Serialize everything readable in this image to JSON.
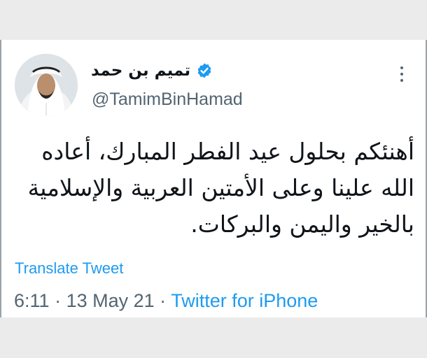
{
  "tweet": {
    "author": {
      "display_name": "تميم بن حمد",
      "handle": "@TamimBinHamad",
      "verified": true
    },
    "text_lines": [
      "أهنئكم بحلول عيد الفطر المبارك، أعاده",
      "الله علينا وعلى الأمتين العربية والإسلامية",
      "بالخير واليمن والبركات."
    ],
    "translate_label": "Translate Tweet",
    "time": "6:11",
    "separator": "·",
    "date": "13 May 21",
    "source": "Twitter for iPhone"
  },
  "icons": {
    "verified": "verified-badge-icon",
    "more": "more-options-icon"
  },
  "colors": {
    "accent": "#1d9bf0",
    "secondary_text": "#536471",
    "primary_text": "#0f1419",
    "page_background": "#ebebeb",
    "card_background": "#ffffff"
  }
}
